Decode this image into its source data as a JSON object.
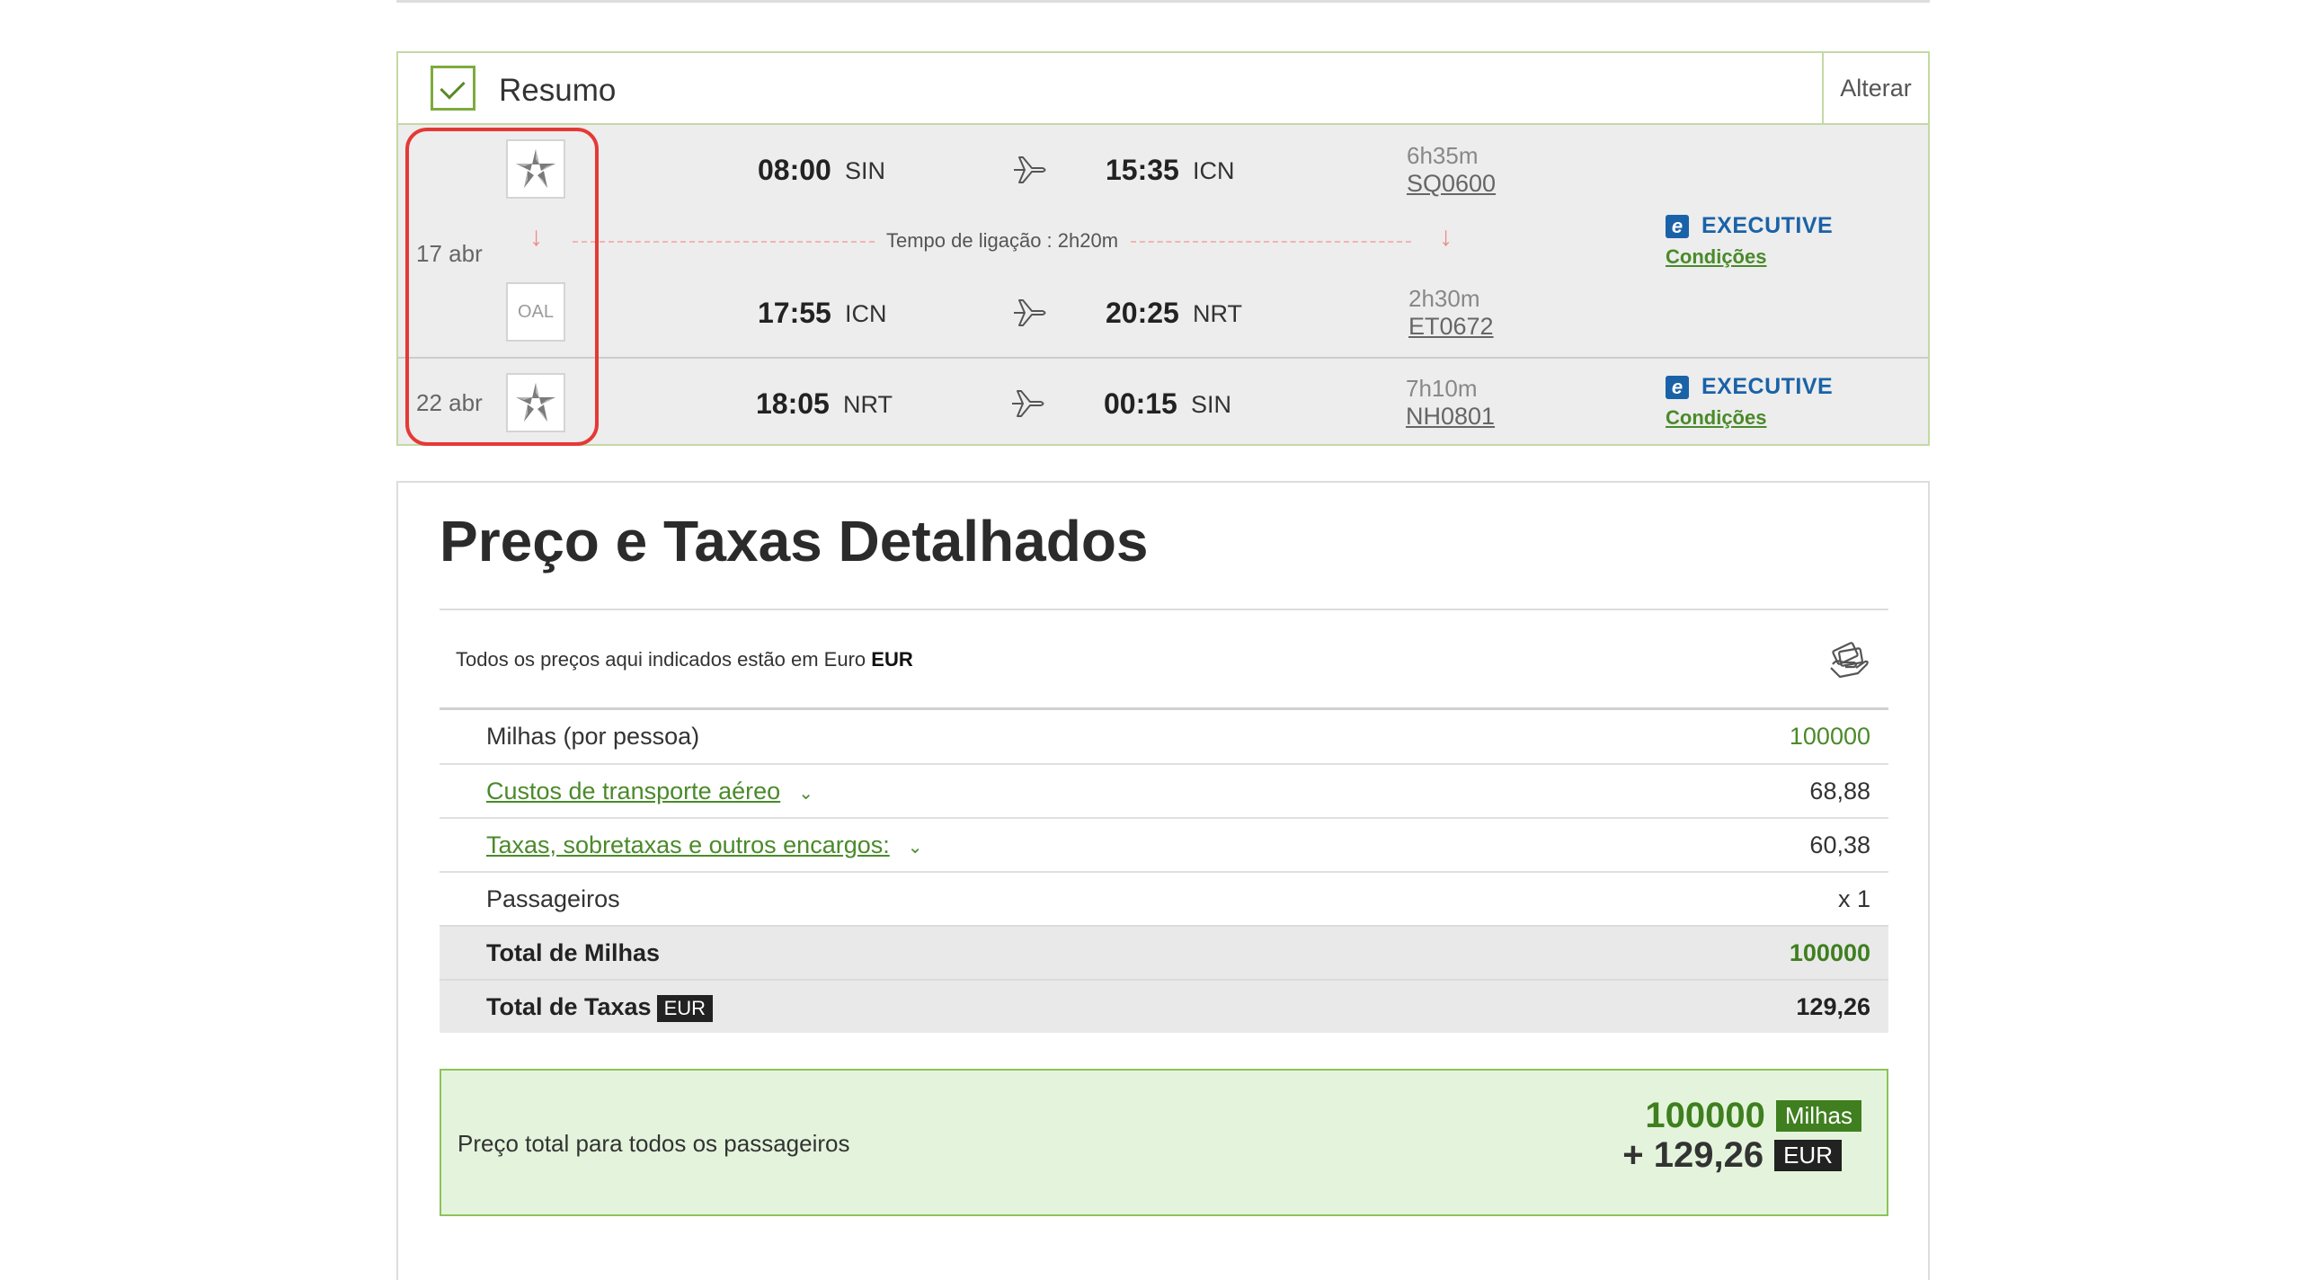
{
  "summary": {
    "title": "Resumo",
    "change_label": "Alterar",
    "outbound": {
      "date": "17 abr",
      "legs": [
        {
          "logo": "star-alliance-logo",
          "depart_time": "08:00",
          "depart_code": "SIN",
          "arrive_time": "15:35",
          "arrive_code": "ICN",
          "duration": "6h35m",
          "flight": "SQ0600"
        },
        {
          "logo_text": "OAL",
          "depart_time": "17:55",
          "depart_code": "ICN",
          "arrive_time": "20:25",
          "arrive_code": "NRT",
          "duration": "2h30m",
          "flight": "ET0672"
        }
      ],
      "layover": "Tempo de ligação : 2h20m",
      "cabin": "EXECUTIVE",
      "conditions": "Condições"
    },
    "inbound": {
      "date": "22 abr",
      "depart_time": "18:05",
      "depart_code": "NRT",
      "arrive_time": "00:15",
      "arrive_code": "SIN",
      "duration": "7h10m",
      "flight": "NH0801",
      "cabin": "EXECUTIVE",
      "conditions": "Condições"
    }
  },
  "price": {
    "title": "Preço e Taxas Detalhados",
    "currency_note_prefix": "Todos os preços aqui indicados estão em Euro",
    "currency_note_code": "EUR",
    "rows": [
      {
        "label": "Milhas (por pessoa)",
        "value": "100000"
      },
      {
        "label": "Custos de transporte aéreo",
        "value": "68,88"
      },
      {
        "label": "Taxas, sobretaxas e outros encargos:",
        "value": "60,38"
      },
      {
        "label": "Passageiros",
        "value": "x 1"
      }
    ],
    "total_miles": {
      "label": "Total de Milhas",
      "value": "100000"
    },
    "total_taxes": {
      "label": "Total de Taxas",
      "badge": "EUR",
      "value": "129,26"
    },
    "grand": {
      "label": "Preço total para todos os passageiros",
      "miles": "100000",
      "miles_badge": "Milhas",
      "eur": "+ 129,26",
      "eur_badge": "EUR"
    }
  },
  "colors": {
    "accent_green": "#4a8a2a",
    "executive_blue": "#1a62a8",
    "highlight_red": "#e53935"
  }
}
